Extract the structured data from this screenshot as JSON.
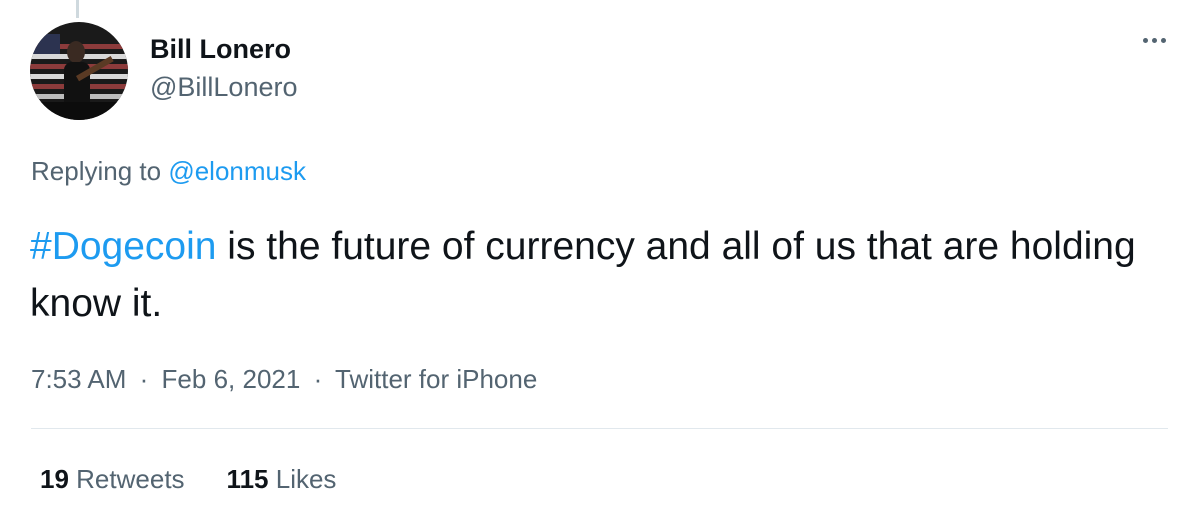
{
  "tweet": {
    "author": {
      "display_name": "Bill Lonero",
      "handle": "@BillLonero",
      "avatar_icon": "user-avatar"
    },
    "more_icon": "more-horizontal-icon",
    "replying_prefix": "Replying to",
    "replying_to": "@elonmusk",
    "text": {
      "hashtag": "#Dogecoin",
      "rest": " is the future of currency and all of us that are holding know it."
    },
    "meta": {
      "time": "7:53 AM",
      "separator_1": "·",
      "date": "Feb 6, 2021",
      "separator_2": "·",
      "source": "Twitter for iPhone"
    },
    "stats": {
      "retweets_count": "19",
      "retweets_label": "Retweets",
      "likes_count": "115",
      "likes_label": "Likes"
    }
  },
  "colors": {
    "link": "#1d9bf0",
    "text": "#0f1419",
    "secondary": "#536471",
    "divider": "#e1e8ed"
  }
}
